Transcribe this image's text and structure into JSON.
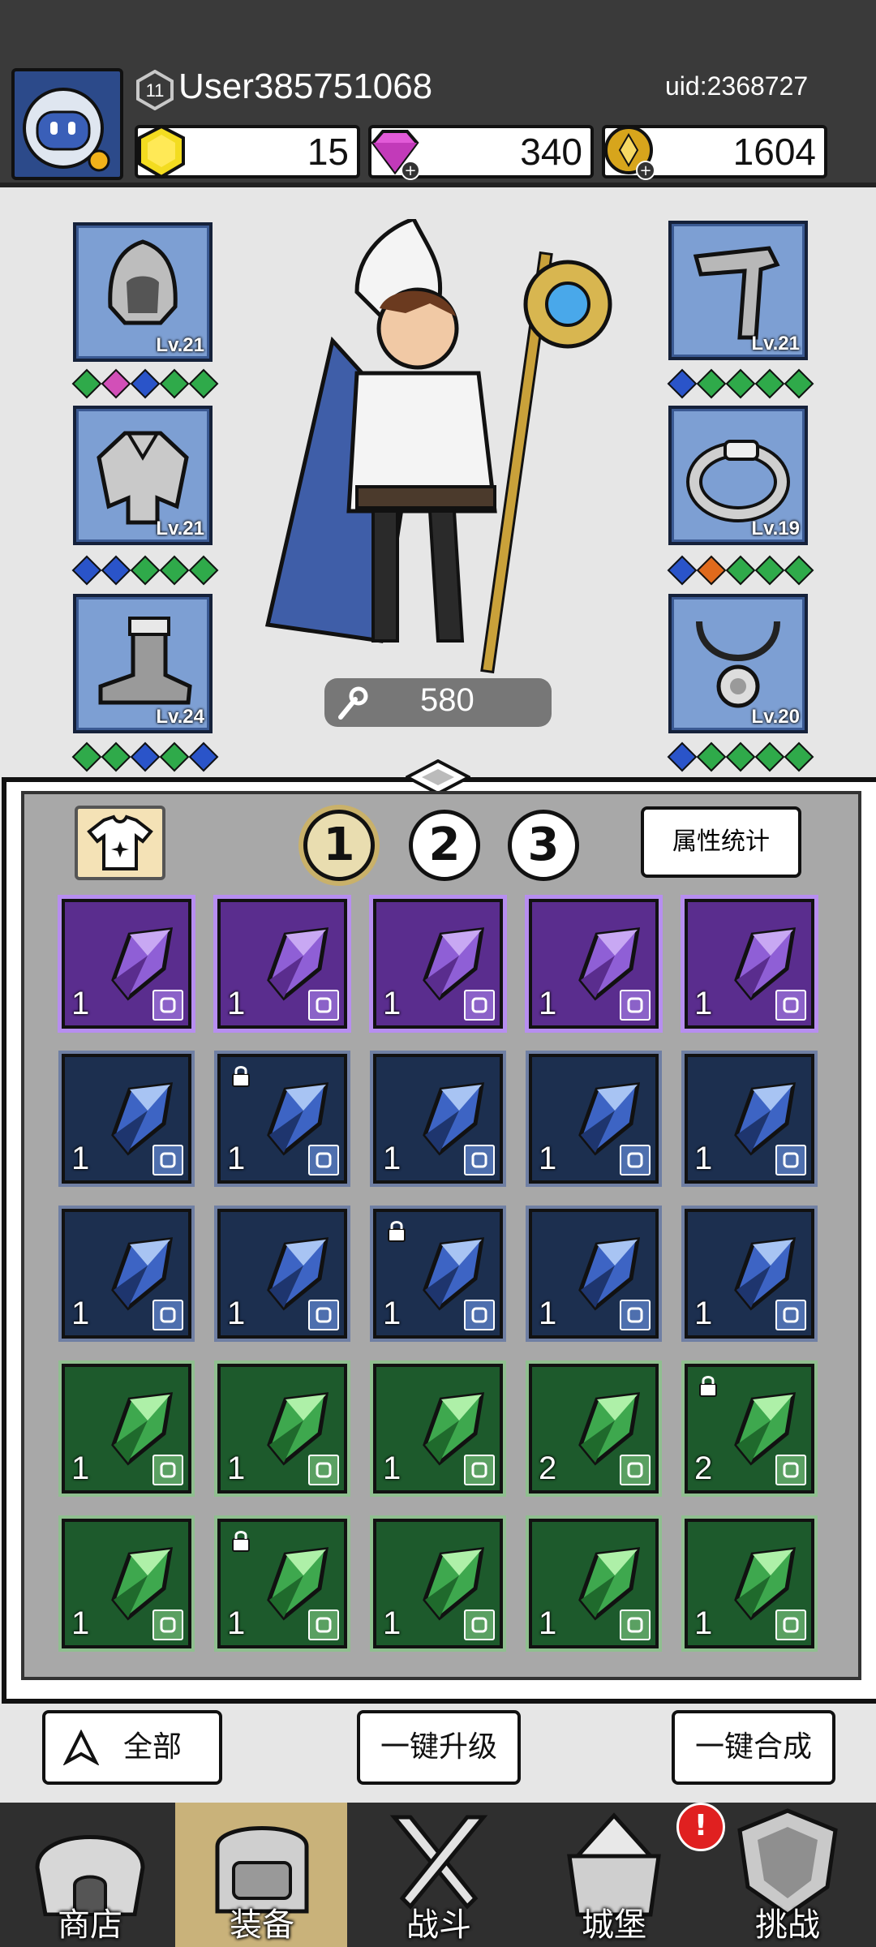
{
  "header": {
    "player_level": "11",
    "username": "User385751068",
    "uid": "uid:2368727",
    "currencies": [
      {
        "name": "gold-gem",
        "value": "15",
        "icon": "yellow-gem-icon"
      },
      {
        "name": "diamond",
        "value": "340",
        "icon": "pink-diamond-icon"
      },
      {
        "name": "coin",
        "value": "1604",
        "icon": "gold-coin-icon"
      }
    ]
  },
  "equipment": {
    "left": [
      {
        "slot": "helmet",
        "level": "Lv.21",
        "icon": "hood-icon",
        "gems": [
          "#2faa4a",
          "#d24fb8",
          "#2a54c9",
          "#2faa4a",
          "#2faa4a"
        ]
      },
      {
        "slot": "armor",
        "level": "Lv.21",
        "icon": "cloak-armor-icon",
        "gems": [
          "#2a54c9",
          "#2a54c9",
          "#2faa4a",
          "#2faa4a",
          "#2faa4a"
        ]
      },
      {
        "slot": "boots",
        "level": "Lv.24",
        "icon": "boot-icon",
        "gems": [
          "#2faa4a",
          "#2faa4a",
          "#2a54c9",
          "#2faa4a",
          "#2a54c9"
        ]
      }
    ],
    "right": [
      {
        "slot": "weapon",
        "level": "Lv.21",
        "icon": "staff-icon",
        "gems": [
          "#2a54c9",
          "#2faa4a",
          "#2faa4a",
          "#2faa4a",
          "#2faa4a"
        ]
      },
      {
        "slot": "ring",
        "level": "Lv.19",
        "icon": "ring-icon",
        "gems": [
          "#2a54c9",
          "#e06a1c",
          "#2faa4a",
          "#2faa4a",
          "#2faa4a"
        ]
      },
      {
        "slot": "necklace",
        "level": "Lv.20",
        "icon": "necklace-icon",
        "gems": [
          "#2a54c9",
          "#2faa4a",
          "#2faa4a",
          "#2faa4a",
          "#2faa4a"
        ]
      }
    ],
    "power": "580"
  },
  "inventory": {
    "tabs": [
      "1",
      "2",
      "3"
    ],
    "active_tab": "1",
    "stats_button": "属性统计",
    "rows": [
      [
        {
          "rarity": "purple",
          "qty": "1",
          "type": "armor",
          "locked": false
        },
        {
          "rarity": "purple",
          "qty": "1",
          "type": "weapon",
          "locked": false
        },
        {
          "rarity": "purple",
          "qty": "1",
          "type": "helmet",
          "locked": false
        },
        {
          "rarity": "purple",
          "qty": "1",
          "type": "necklace",
          "locked": false
        },
        {
          "rarity": "purple",
          "qty": "1",
          "type": "necklace",
          "locked": false
        }
      ],
      [
        {
          "rarity": "blue",
          "qty": "1",
          "type": "ring",
          "locked": false
        },
        {
          "rarity": "blue",
          "qty": "1",
          "type": "armor",
          "locked": true
        },
        {
          "rarity": "blue",
          "qty": "1",
          "type": "armor",
          "locked": false
        },
        {
          "rarity": "blue",
          "qty": "1",
          "type": "boots",
          "locked": false
        },
        {
          "rarity": "blue",
          "qty": "1",
          "type": "boots",
          "locked": false
        }
      ],
      [
        {
          "rarity": "blue",
          "qty": "1",
          "type": "boots",
          "locked": false
        },
        {
          "rarity": "blue",
          "qty": "1",
          "type": "boots",
          "locked": false
        },
        {
          "rarity": "blue",
          "qty": "1",
          "type": "weapon",
          "locked": true
        },
        {
          "rarity": "blue",
          "qty": "1",
          "type": "helmet",
          "locked": false
        },
        {
          "rarity": "blue",
          "qty": "1",
          "type": "helmet",
          "locked": false
        }
      ],
      [
        {
          "rarity": "green",
          "qty": "1",
          "type": "ring",
          "locked": false
        },
        {
          "rarity": "green",
          "qty": "1",
          "type": "boots",
          "locked": false
        },
        {
          "rarity": "green",
          "qty": "1",
          "type": "boots",
          "locked": false
        },
        {
          "rarity": "green",
          "qty": "2",
          "type": "boots",
          "locked": false
        },
        {
          "rarity": "green",
          "qty": "2",
          "type": "weapon",
          "locked": true
        }
      ],
      [
        {
          "rarity": "green",
          "qty": "1",
          "type": "weapon",
          "locked": false
        },
        {
          "rarity": "green",
          "qty": "1",
          "type": "helmet",
          "locked": true
        },
        {
          "rarity": "green",
          "qty": "1",
          "type": "necklace",
          "locked": false
        },
        {
          "rarity": "green",
          "qty": "1",
          "type": "necklace",
          "locked": false
        },
        {
          "rarity": "green",
          "qty": "1",
          "type": "necklace",
          "locked": false
        }
      ]
    ]
  },
  "actions": {
    "filter_label": "全部",
    "upgrade_label": "一键升级",
    "merge_label": "一键合成"
  },
  "nav": {
    "items": [
      {
        "label": "商店",
        "icon": "shop-icon"
      },
      {
        "label": "装备",
        "icon": "backpack-icon"
      },
      {
        "label": "战斗",
        "icon": "crossed-swords-icon"
      },
      {
        "label": "城堡",
        "icon": "castle-icon"
      },
      {
        "label": "挑战",
        "icon": "shield-icon"
      }
    ],
    "active": "装备",
    "notification": "!"
  },
  "colors": {
    "purple": "#5a2d8e",
    "blue": "#1c2f4f",
    "green": "#1d5a2c",
    "slot_blue": "#7d9fd3"
  }
}
